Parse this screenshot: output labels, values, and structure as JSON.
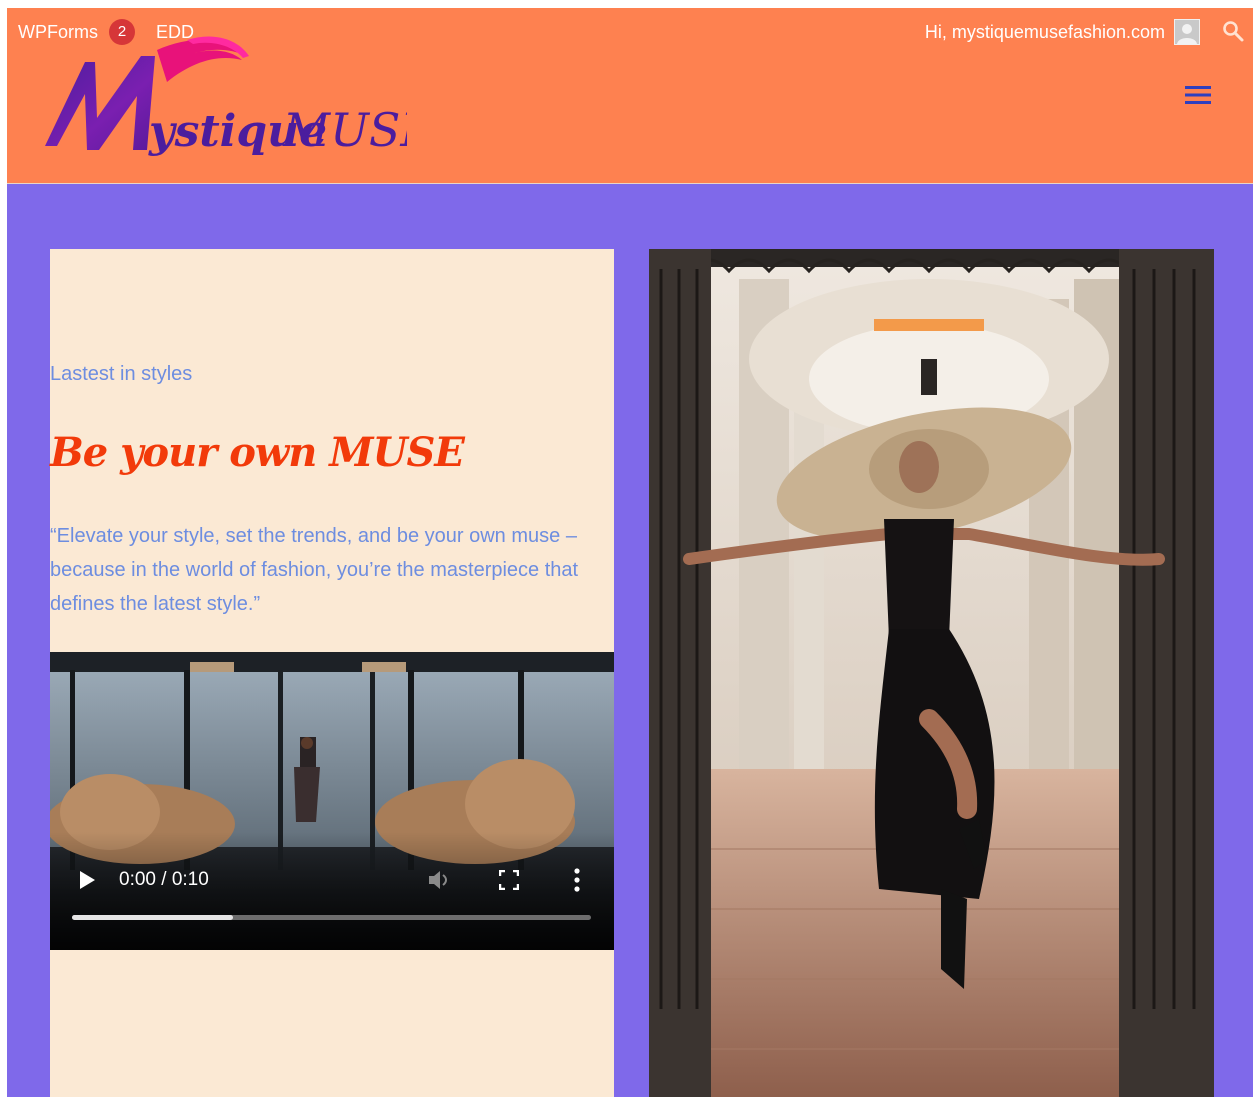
{
  "admin_bar": {
    "wpforms_label": "WPForms",
    "wpforms_badge": "2",
    "edd_label": "EDD",
    "greeting": "Hi, mystiquemusefashion.com"
  },
  "site": {
    "logo_text": "MystiqueMUSE"
  },
  "hero": {
    "kicker": "Lastest in styles",
    "headline": "Be your own MUSE",
    "quote": "“Elevate your style, set the trends, and be your own muse – because in the world of fashion, you’re the masterpiece that defines the latest style.”"
  },
  "video": {
    "time": "0:00 / 0:10",
    "progress": 0.31
  },
  "colors": {
    "header_bg": "#fe8150",
    "page_bg": "#7f69ea",
    "panel_bg": "#fbe9d4",
    "headline": "#f23a0a",
    "body_text": "#6d8de0",
    "badge": "#d63638"
  },
  "icons": [
    "user-avatar-icon",
    "search-icon",
    "hamburger-menu-icon",
    "play-icon",
    "volume-icon",
    "fullscreen-icon",
    "more-vertical-icon"
  ]
}
